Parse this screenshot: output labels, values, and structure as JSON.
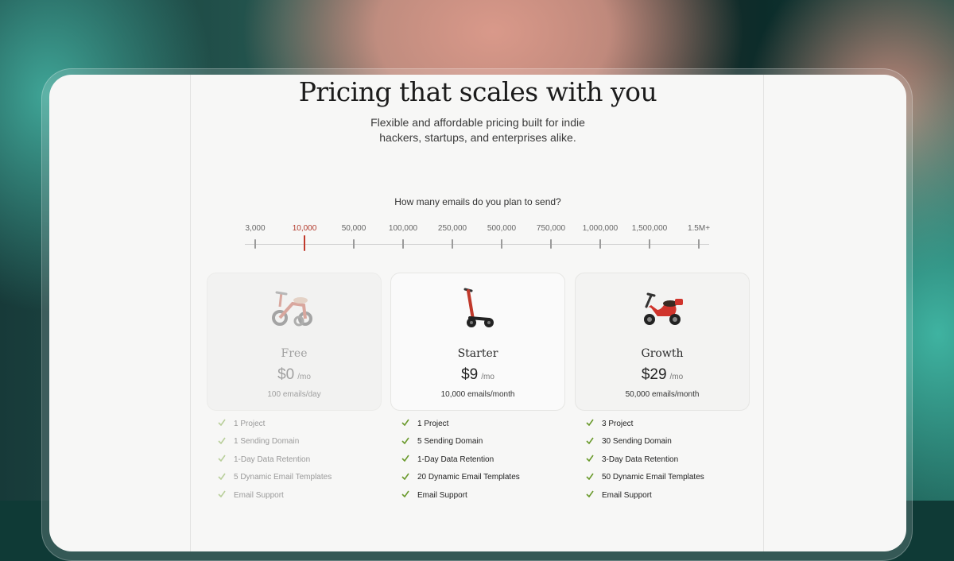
{
  "header": {
    "title": "Pricing that scales with you",
    "subtitle_line1": "Flexible and affordable pricing built for indie",
    "subtitle_line2": "hackers, startups, and enterprises alike."
  },
  "volume_selector": {
    "question": "How many emails do you plan to send?",
    "options": [
      "3,000",
      "10,000",
      "50,000",
      "100,000",
      "250,000",
      "500,000",
      "750,000",
      "1,000,000",
      "1,500,000",
      "1.5M+"
    ],
    "selected": "10,000"
  },
  "plans": [
    {
      "name": "Free",
      "price": "$0",
      "period": "/mo",
      "volume": "100 emails/day",
      "icon": "tricycle-icon",
      "features": [
        "1 Project",
        "1 Sending Domain",
        "1-Day Data Retention",
        "5 Dynamic Email Templates",
        "Email Support"
      ]
    },
    {
      "name": "Starter",
      "price": "$9",
      "period": "/mo",
      "volume": "10,000 emails/month",
      "icon": "scooter-icon",
      "features": [
        "1 Project",
        "5 Sending Domain",
        "1-Day Data Retention",
        "20 Dynamic Email Templates",
        "Email Support"
      ]
    },
    {
      "name": "Growth",
      "price": "$29",
      "period": "/mo",
      "volume": "50,000 emails/month",
      "icon": "moped-icon",
      "features": [
        "3 Project",
        "30 Sending Domain",
        "3-Day Data Retention",
        "50 Dynamic Email Templates",
        "Email Support"
      ]
    }
  ],
  "colors": {
    "accent": "#c0392b",
    "check": "#6a9a2c"
  }
}
